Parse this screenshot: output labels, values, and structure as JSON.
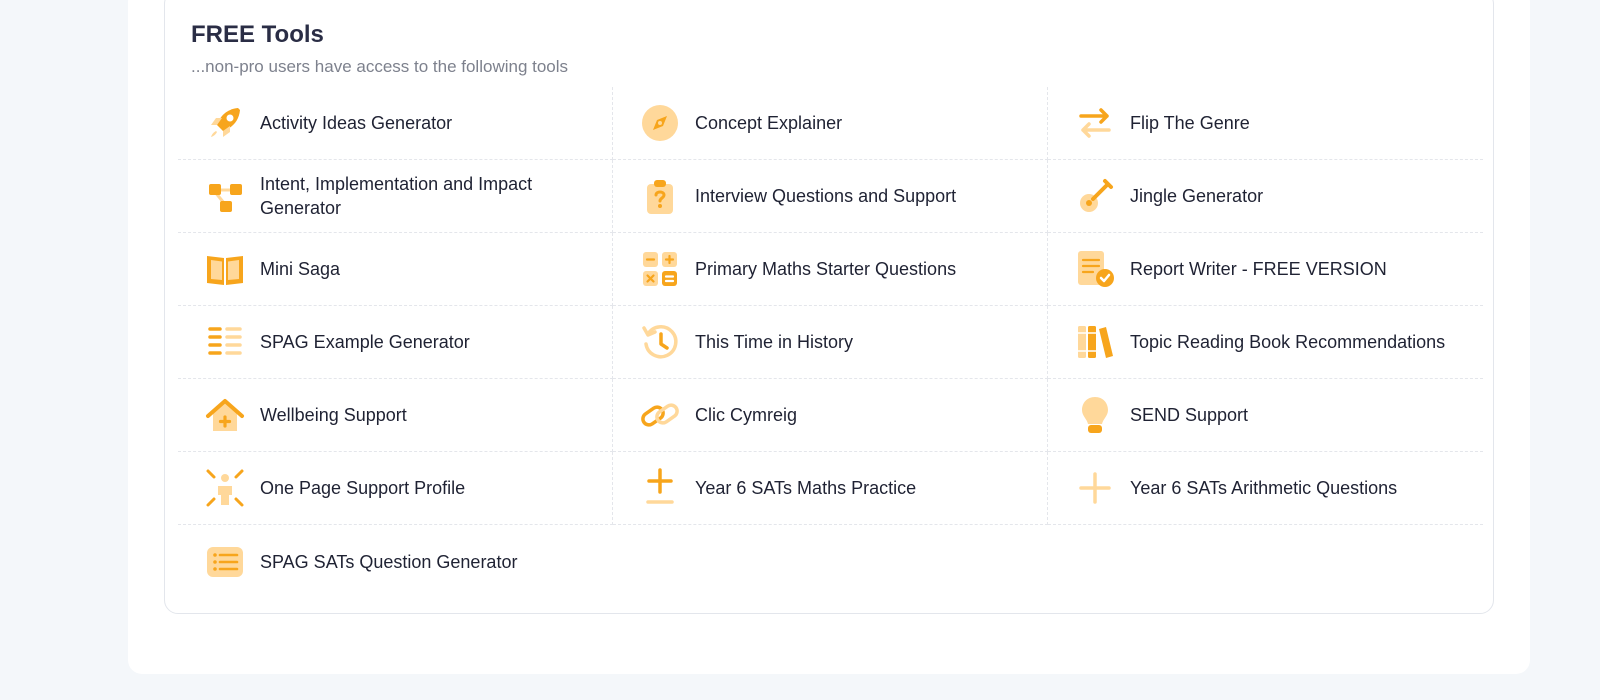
{
  "section": {
    "title": "FREE Tools",
    "subtitle": "...non-pro users have access to the following tools"
  },
  "colors": {
    "accent": "#f7a51c",
    "accent_light": "#ffd89a"
  },
  "tools": [
    {
      "label": "Activity Ideas Generator",
      "icon": "rocket-icon"
    },
    {
      "label": "Concept Explainer",
      "icon": "compass-icon"
    },
    {
      "label": "Flip The Genre",
      "icon": "swap-arrows-icon"
    },
    {
      "label": "Intent, Implementation and Impact Generator",
      "icon": "flow-diagram-icon"
    },
    {
      "label": "Interview Questions and Support",
      "icon": "clipboard-question-icon"
    },
    {
      "label": "Jingle Generator",
      "icon": "guitar-icon"
    },
    {
      "label": "Mini Saga",
      "icon": "open-book-icon"
    },
    {
      "label": "Primary Maths Starter Questions",
      "icon": "calculator-icon"
    },
    {
      "label": "Report Writer - FREE VERSION",
      "icon": "report-check-icon"
    },
    {
      "label": "SPAG Example Generator",
      "icon": "text-list-icon"
    },
    {
      "label": "This Time in History",
      "icon": "history-clock-icon"
    },
    {
      "label": "Topic Reading Book Recommendations",
      "icon": "books-icon"
    },
    {
      "label": "Wellbeing Support",
      "icon": "home-plus-icon"
    },
    {
      "label": "Clic Cymreig",
      "icon": "chain-link-icon"
    },
    {
      "label": "SEND Support",
      "icon": "lightbulb-icon"
    },
    {
      "label": "One Page Support Profile",
      "icon": "person-highlight-icon"
    },
    {
      "label": "Year 6 SATs Maths Practice",
      "icon": "plus-underline-icon"
    },
    {
      "label": "Year 6 SATs Arithmetic Questions",
      "icon": "plus-icon"
    },
    {
      "label": "SPAG SATs Question Generator",
      "icon": "list-card-icon"
    }
  ]
}
